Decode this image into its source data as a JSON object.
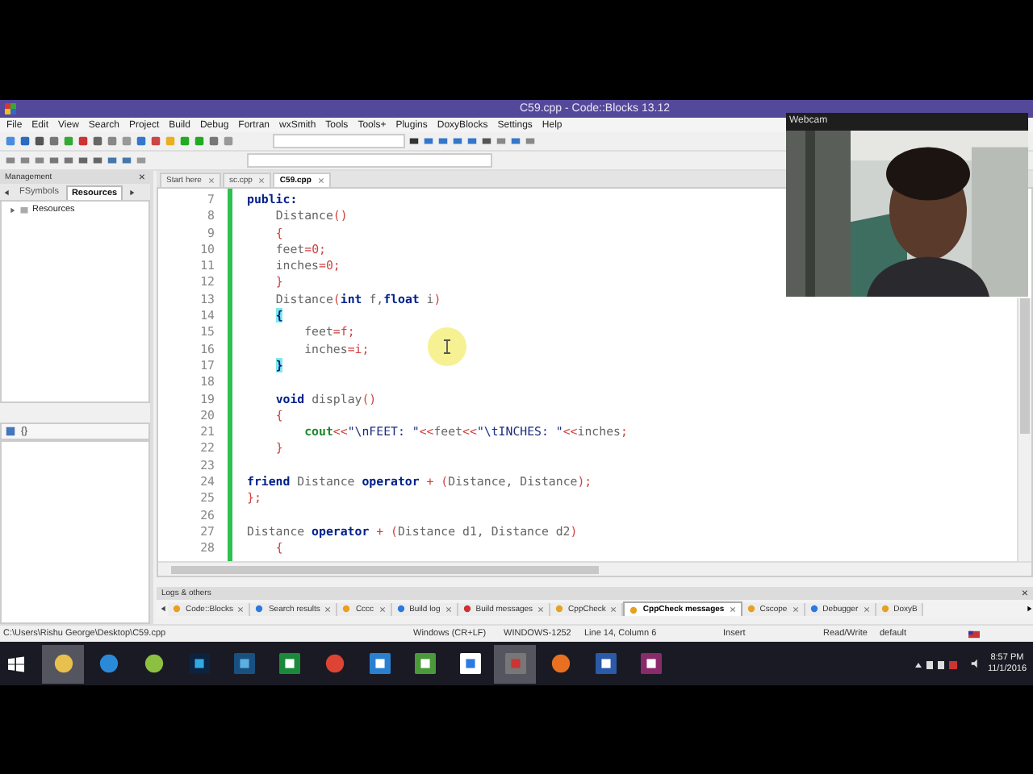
{
  "window": {
    "title": "C59.cpp - Code::Blocks 13.12"
  },
  "menu": [
    "File",
    "Edit",
    "View",
    "Search",
    "Project",
    "Build",
    "Debug",
    "Fortran",
    "wxSmith",
    "Tools",
    "Tools+",
    "Plugins",
    "DoxyBlocks",
    "Settings",
    "Help"
  ],
  "management": {
    "title": "Management",
    "close": "×",
    "tabs": [
      {
        "label": "FSymbols",
        "selected": false
      },
      {
        "label": "Resources",
        "selected": true
      }
    ],
    "tree": [
      {
        "label": "Resources",
        "expanded": false
      }
    ],
    "lower_text": "{}"
  },
  "editor_tabs": [
    {
      "label": "Start here",
      "selected": false
    },
    {
      "label": "sc.cpp",
      "selected": false
    },
    {
      "label": "C59.cpp",
      "selected": true
    }
  ],
  "code": [
    {
      "number": "7",
      "tokens": [
        {
          "kind": "kw",
          "text": "public:"
        }
      ]
    },
    {
      "number": "8",
      "tokens": [
        {
          "kind": "id",
          "text": "    Distance"
        },
        {
          "kind": "op",
          "text": "()"
        }
      ]
    },
    {
      "number": "9",
      "tokens": [
        {
          "kind": "op",
          "text": "    {"
        }
      ]
    },
    {
      "number": "10",
      "tokens": [
        {
          "kind": "id",
          "text": "    feet"
        },
        {
          "kind": "op",
          "text": "=0;"
        }
      ]
    },
    {
      "number": "11",
      "tokens": [
        {
          "kind": "id",
          "text": "    inches"
        },
        {
          "kind": "op",
          "text": "=0;"
        }
      ]
    },
    {
      "number": "12",
      "tokens": [
        {
          "kind": "op",
          "text": "    }"
        }
      ]
    },
    {
      "number": "13",
      "tokens": [
        {
          "kind": "id",
          "text": "    Distance"
        },
        {
          "kind": "op",
          "text": "("
        },
        {
          "kind": "kw",
          "text": "int"
        },
        {
          "kind": "id",
          "text": " f,"
        },
        {
          "kind": "kw",
          "text": "float"
        },
        {
          "kind": "id",
          "text": " i"
        },
        {
          "kind": "op",
          "text": ")"
        }
      ]
    },
    {
      "number": "14",
      "tokens": [
        {
          "kind": "match",
          "text": "    {"
        }
      ]
    },
    {
      "number": "15",
      "tokens": [
        {
          "kind": "id",
          "text": "        feet"
        },
        {
          "kind": "op",
          "text": "=f;"
        }
      ]
    },
    {
      "number": "16",
      "tokens": [
        {
          "kind": "id",
          "text": "        inches"
        },
        {
          "kind": "op",
          "text": "=i;"
        }
      ]
    },
    {
      "number": "17",
      "tokens": [
        {
          "kind": "match",
          "text": "    }"
        }
      ]
    },
    {
      "number": "18"
    },
    {
      "number": "19",
      "tokens": [
        {
          "kind": "kw",
          "text": "    void"
        },
        {
          "kind": "id",
          "text": " display"
        },
        {
          "kind": "op",
          "text": "()"
        }
      ]
    },
    {
      "number": "20",
      "tokens": [
        {
          "kind": "op",
          "text": "    {"
        }
      ]
    },
    {
      "number": "21",
      "tokens": [
        {
          "kind": "fn",
          "text": "        cout"
        },
        {
          "kind": "op",
          "text": "<<"
        },
        {
          "kind": "str",
          "text": "\"\\nFEET: \""
        },
        {
          "kind": "op",
          "text": "<<"
        },
        {
          "kind": "id",
          "text": "feet"
        },
        {
          "kind": "op",
          "text": "<<"
        },
        {
          "kind": "str",
          "text": "\"\\tINCHES: \""
        },
        {
          "kind": "op",
          "text": "<<"
        },
        {
          "kind": "id",
          "text": "inches"
        },
        {
          "kind": "op",
          "text": ";"
        }
      ]
    },
    {
      "number": "22",
      "tokens": [
        {
          "kind": "op",
          "text": "    }"
        }
      ]
    },
    {
      "number": "23"
    },
    {
      "number": "24",
      "tokens": [
        {
          "kind": "kw",
          "text": "friend"
        },
        {
          "kind": "id",
          "text": " Distance "
        },
        {
          "kind": "kw",
          "text": "operator"
        },
        {
          "kind": "op",
          "text": " + ("
        },
        {
          "kind": "id",
          "text": "Distance, Distance"
        },
        {
          "kind": "op",
          "text": ");"
        }
      ]
    },
    {
      "number": "25",
      "tokens": [
        {
          "kind": "op",
          "text": "};"
        }
      ]
    },
    {
      "number": "26"
    },
    {
      "number": "27",
      "tokens": [
        {
          "kind": "id",
          "text": "Distance "
        },
        {
          "kind": "kw",
          "text": "operator"
        },
        {
          "kind": "op",
          "text": " + ("
        },
        {
          "kind": "id",
          "text": "Distance d1, Distance d2"
        },
        {
          "kind": "op",
          "text": ")"
        }
      ]
    },
    {
      "number": "28",
      "tokens": [
        {
          "kind": "op",
          "text": "    {"
        }
      ]
    }
  ],
  "logs": {
    "title": "Logs & others",
    "close": "×",
    "tabs": [
      {
        "label": "Code::Blocks",
        "selected": false
      },
      {
        "label": "Search results",
        "selected": false
      },
      {
        "label": "Cccc",
        "selected": false
      },
      {
        "label": "Build log",
        "selected": false
      },
      {
        "label": "Build messages",
        "selected": false
      },
      {
        "label": "CppCheck",
        "selected": false
      },
      {
        "label": "CppCheck messages",
        "selected": true
      },
      {
        "label": "Cscope",
        "selected": false
      },
      {
        "label": "Debugger",
        "selected": false
      },
      {
        "label": "DoxyB",
        "selected": false
      }
    ]
  },
  "status_bar": {
    "path": "C:\\Users\\Rishu George\\Desktop\\C59.cpp",
    "line_endings": "Windows (CR+LF)",
    "encoding": "WINDOWS-1252",
    "position": "Line 14, Column 6",
    "mode": "Insert",
    "access": "Read/Write",
    "profile": "default"
  },
  "webcam": {
    "title": "Webcam",
    "kind": "picture"
  },
  "taskbar": {
    "time": "8:57 PM",
    "date": "11/1/2016"
  }
}
